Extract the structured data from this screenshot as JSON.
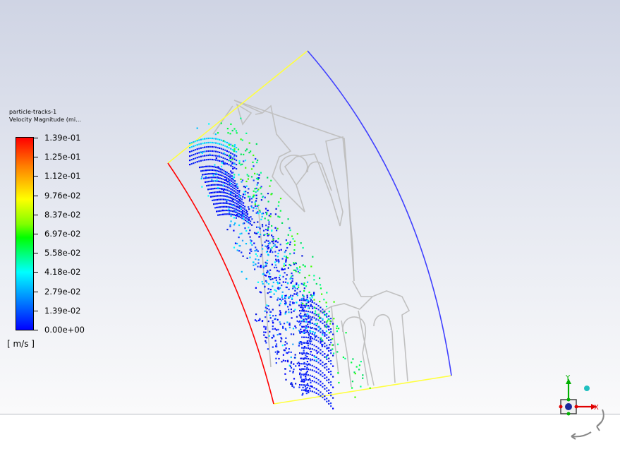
{
  "legend": {
    "title_line1": "particle-tracks-1",
    "title_line2": "Velocity Magnitude (mi...",
    "ticks": [
      "1.39e-01",
      "1.25e-01",
      "1.12e-01",
      "9.76e-02",
      "8.37e-02",
      "6.97e-02",
      "5.58e-02",
      "4.18e-02",
      "2.79e-02",
      "1.39e-02",
      "0.00e+00"
    ],
    "units": "[ m/s ]",
    "colormap": [
      "#ff0000",
      "#ff8000",
      "#ffff00",
      "#80ff00",
      "#00ff00",
      "#00ffff",
      "#0080ff",
      "#0000ff"
    ]
  },
  "axes_triad": {
    "y_label": "Y",
    "x_label": "X",
    "y_color": "#00b000",
    "x_color": "#e00000"
  },
  "viewport": {
    "geometry_color": "#c0c0c0",
    "inlet_boundary_color": "#ff0000",
    "outlet_boundary_color": "#4040ff",
    "periodic_boundary_color": "#ffff40"
  }
}
